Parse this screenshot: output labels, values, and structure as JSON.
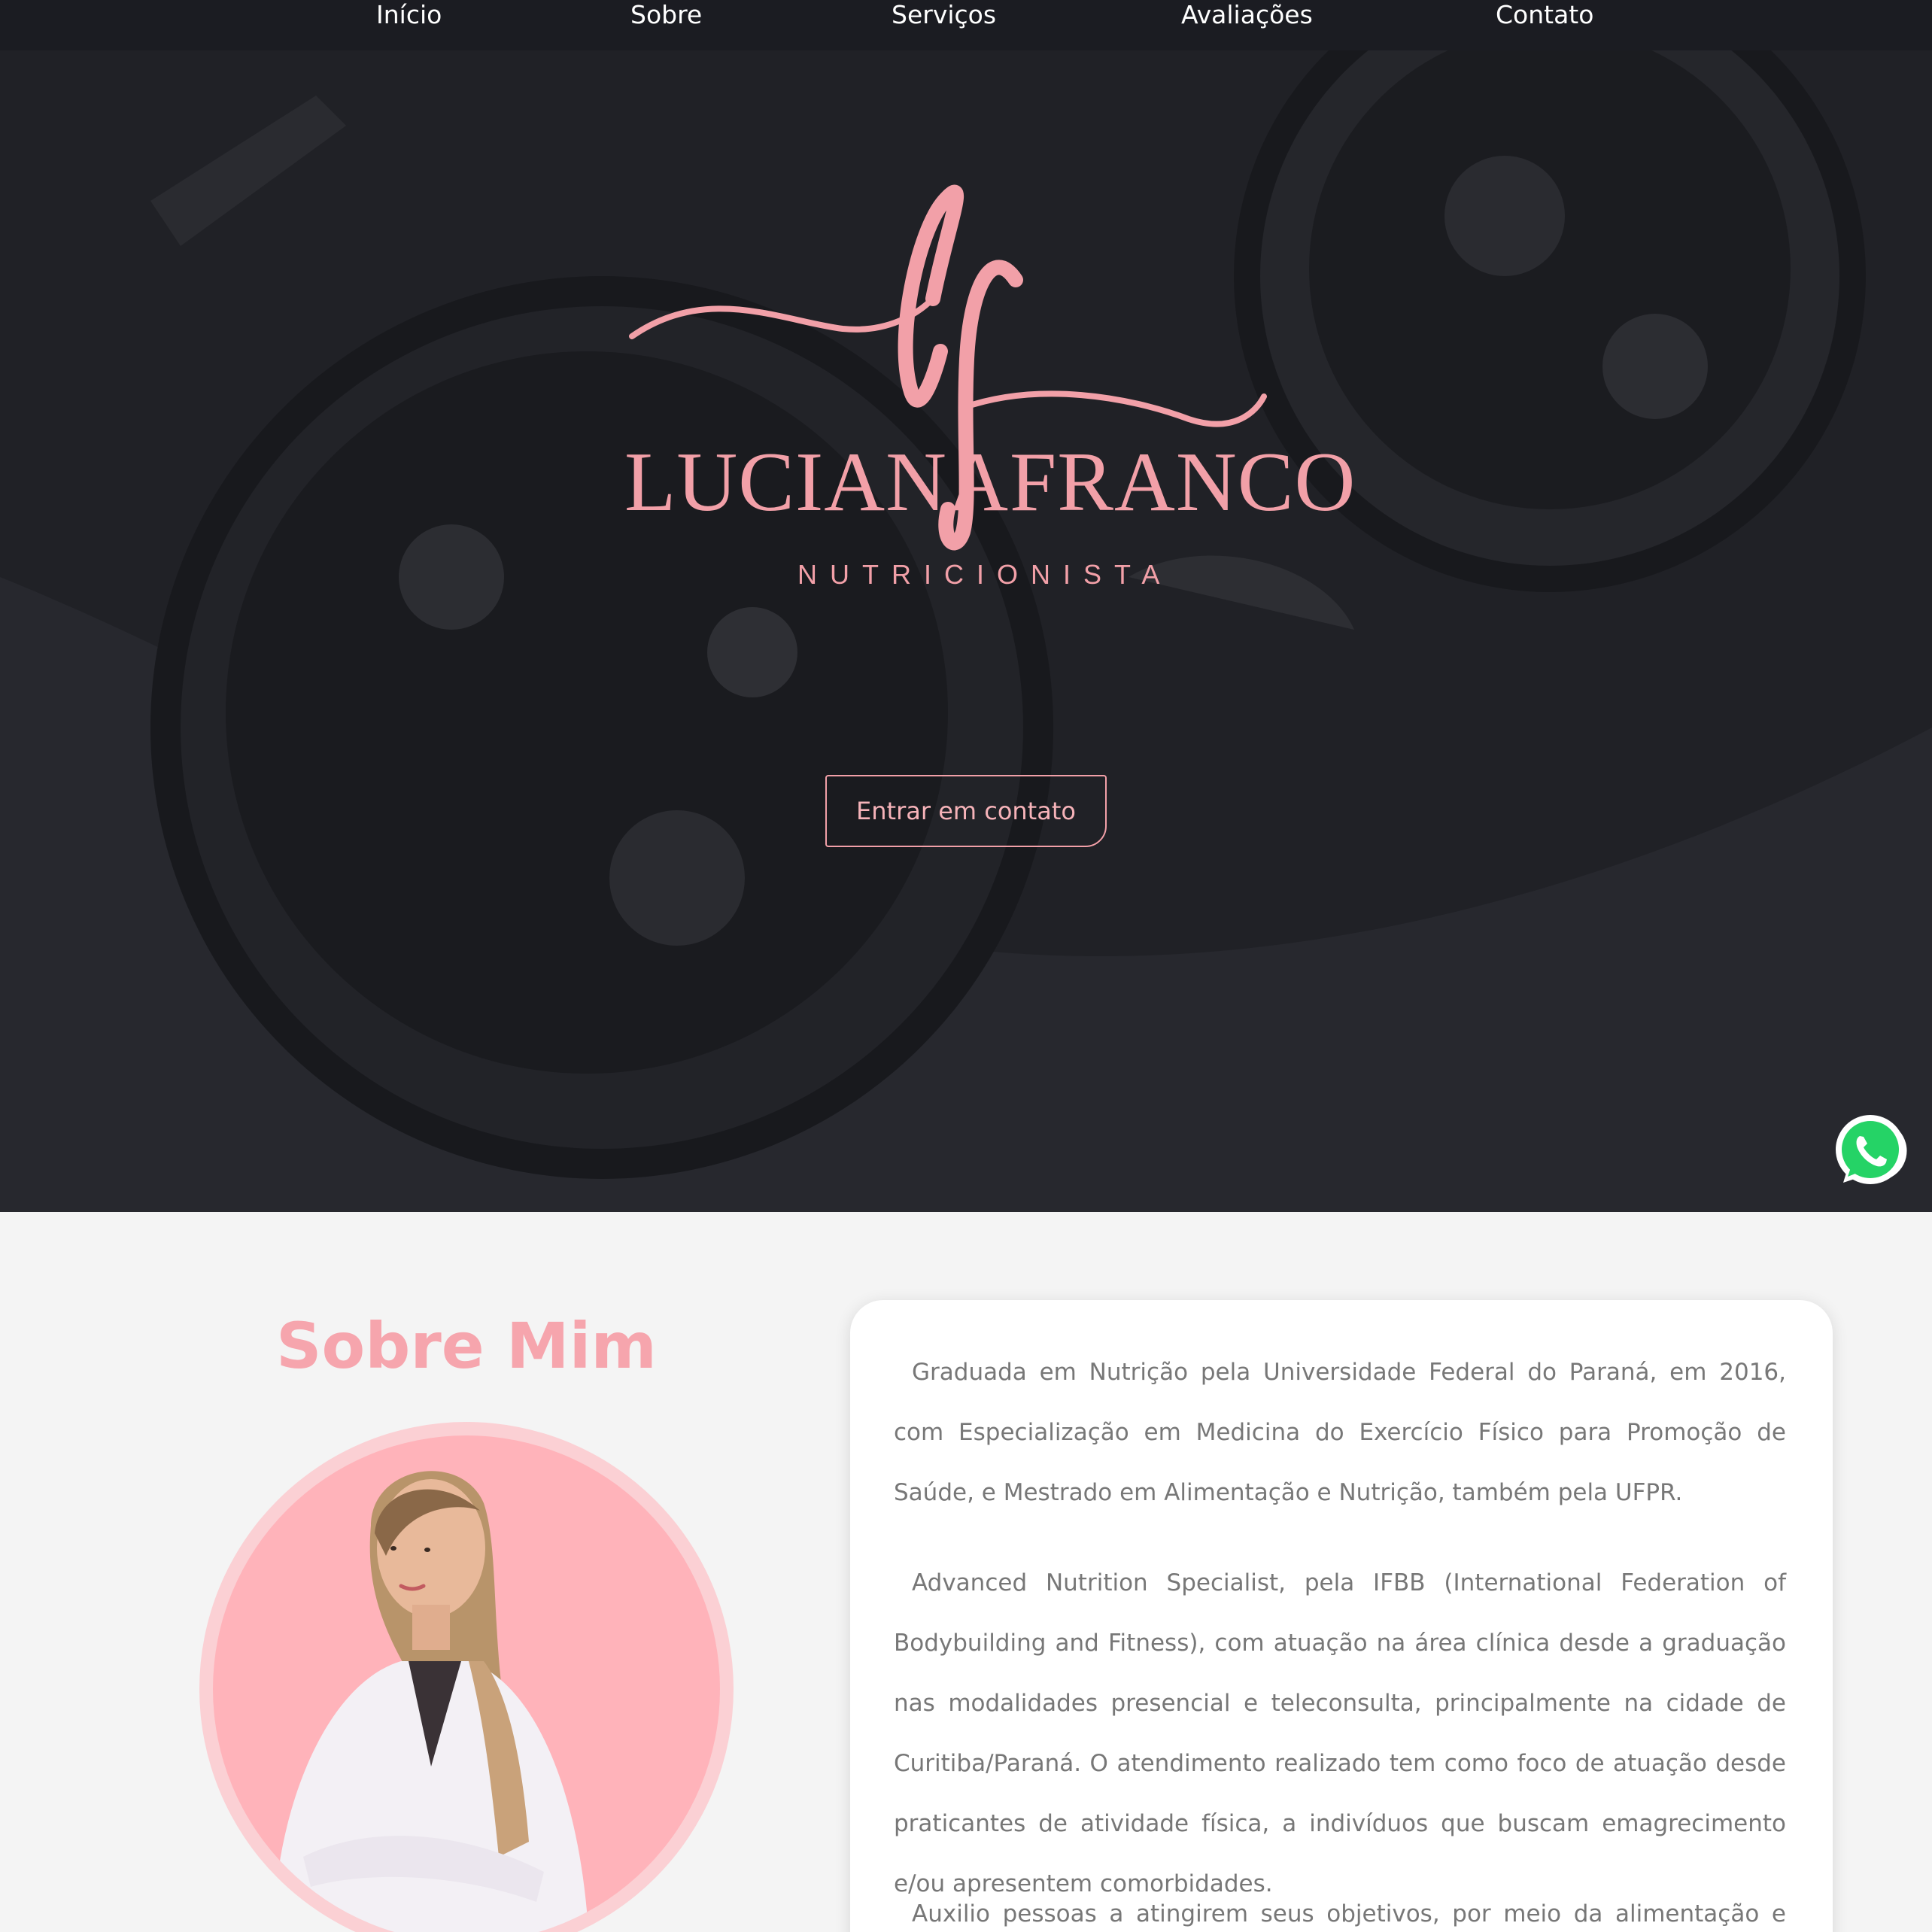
{
  "nav": {
    "items": [
      {
        "label": "Início"
      },
      {
        "label": "Sobre"
      },
      {
        "label": "Serviços"
      },
      {
        "label": "Avaliações"
      },
      {
        "label": "Contato"
      }
    ]
  },
  "hero": {
    "logo_left": "LUCIANA",
    "logo_right": "FRANCO",
    "tagline": "NUTRICIONISTA",
    "cta_label": "Entrar em contato"
  },
  "whatsapp": {
    "icon": "whatsapp-icon",
    "color": "#25d366"
  },
  "about": {
    "title": "Sobre Mim",
    "paragraphs": [
      "Graduada em Nutrição pela Universidade Federal do Paraná, em 2016, com Especialização em Medicina do Exercício Físico para Promoção de Saúde, e Mestrado em Alimentação e Nutrição, também pela UFPR.",
      "Advanced Nutrition Specialist, pela IFBB (International Federation of Bodybuilding and Fitness), com atuação na área clínica desde a graduação nas modalidades presencial e teleconsulta, principalmente na cidade de Curitiba/Paraná. O atendimento realizado tem como foco de atuação desde praticantes de atividade física, a indivíduos que buscam emagrecimento e/ou apresentem comorbidades.",
      "Auxilio pessoas a atingirem seus objetivos, por meio da alimentação e educação"
    ]
  },
  "colors": {
    "accent_pink": "#f2a0a8",
    "nav_bg": "#1b1c22",
    "hero_bg": "#1e1f24",
    "page_bg": "#f4f4f4"
  }
}
